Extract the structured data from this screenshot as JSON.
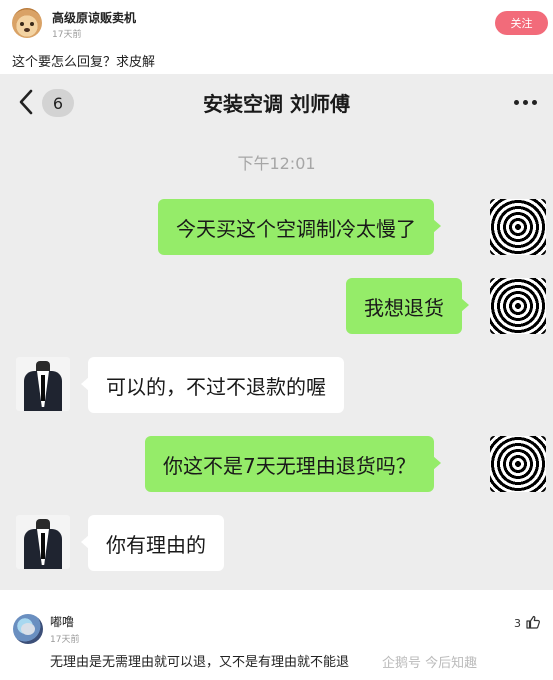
{
  "post": {
    "author": "高级原谅贩卖机",
    "time": "17天前",
    "follow_label": "关注",
    "text": "这个要怎么回复？求皮解"
  },
  "chat": {
    "unread": "6",
    "title": "安装空调 刘师傅",
    "timestamp": "下午12:01",
    "messages": [
      {
        "side": "out",
        "text": "今天买这个空调制冷太慢了"
      },
      {
        "side": "out",
        "text": "我想退货"
      },
      {
        "side": "in",
        "text": "可以的，不过不退款的喔"
      },
      {
        "side": "out",
        "text": "你这不是7天无理由退货吗？"
      },
      {
        "side": "in",
        "text": "你有理由的"
      }
    ]
  },
  "comment": {
    "author": "嘟噜",
    "time": "17天前",
    "likes": "3",
    "text": "无理由是无需理由就可以退，又不是有理由就不能退",
    "watermark": "企鹅号 今后知趣"
  },
  "icons": {
    "back": "chevron-left-icon",
    "more": "more-dots-icon",
    "like": "thumbs-up-icon"
  },
  "colors": {
    "follow": "#f26b7a",
    "bubble_out": "#95ec69",
    "bubble_in": "#ffffff",
    "chat_bg": "#ededed"
  }
}
